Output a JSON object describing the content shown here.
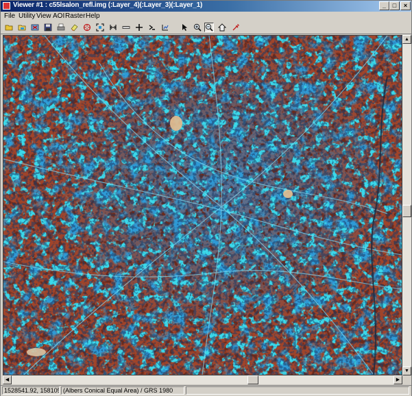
{
  "window": {
    "title": "Viewer #1 : c55lsalon_refl.img (:Layer_4)(:Layer_3)(:Layer_1)",
    "minimize_glyph": "_",
    "maximize_glyph": "□",
    "close_glyph": "×"
  },
  "menubar": {
    "items": [
      {
        "label": "File"
      },
      {
        "label": "Utility"
      },
      {
        "label": "View"
      },
      {
        "label": "AOI"
      },
      {
        "label": "Raster"
      },
      {
        "label": "Help"
      }
    ]
  },
  "toolbar": {
    "tools": [
      {
        "icon": "open-folder-icon"
      },
      {
        "icon": "open-layer-icon"
      },
      {
        "icon": "close-layer-icon"
      },
      {
        "icon": "save-icon"
      },
      {
        "icon": "print-icon"
      },
      {
        "icon": "erase-icon"
      },
      {
        "icon": "reset-icon"
      },
      {
        "icon": "fit-window-icon"
      },
      {
        "icon": "scale-icon"
      },
      {
        "icon": "measure-icon"
      },
      {
        "icon": "crosshair-icon"
      },
      {
        "icon": "inquire-icon"
      },
      {
        "icon": "info-icon"
      },
      {
        "icon": "select-arrow-icon"
      },
      {
        "icon": "zoom-in-icon"
      },
      {
        "icon": "zoom-out-icon"
      },
      {
        "icon": "roam-icon"
      },
      {
        "icon": "pan-icon"
      }
    ]
  },
  "status": {
    "coordinates": "1528541.92, 1581052.21",
    "projection": "(Albers Conical Equal Area) / GRS 1980"
  },
  "colors": {
    "land": "#a0442a",
    "vegetation_dark": "#6b2a1e",
    "urban": "#2d9ad6",
    "urban_bright": "#38e4f0",
    "urban_gray": "#5a6f86",
    "bare_soil": "#e8c090"
  }
}
